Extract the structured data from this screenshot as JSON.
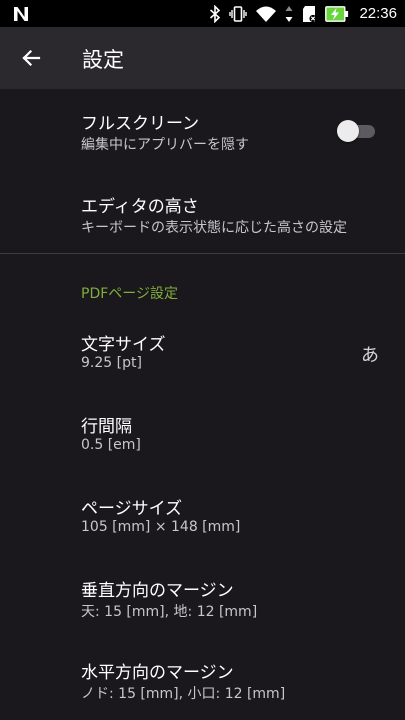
{
  "status_bar": {
    "time": "22:36",
    "icons": [
      "notification-n-icon",
      "bluetooth-icon",
      "vibrate-icon",
      "wifi-icon",
      "data-arrows-icon",
      "sd-card-icon",
      "battery-charging-icon"
    ]
  },
  "app_bar": {
    "back_icon": "arrow-back-icon",
    "title": "設定"
  },
  "settings": {
    "fullscreen": {
      "title": "フルスクリーン",
      "summary": "編集中にアプリバーを隠す",
      "enabled": false
    },
    "editor_height": {
      "title": "エディタの高さ",
      "summary": "キーボードの表示状態に応じた高さの設定"
    },
    "pdf_section": {
      "header": "PDFページ設定",
      "font_size": {
        "title": "文字サイズ",
        "summary": "9.25 [pt]",
        "preview": "あ"
      },
      "line_spacing": {
        "title": "行間隔",
        "summary": "0.5 [em]"
      },
      "page_size": {
        "title": "ページサイズ",
        "summary": "105 [mm] × 148 [mm]"
      },
      "vertical_margin": {
        "title": "垂直方向のマージン",
        "summary": "天: 15 [mm], 地: 12 [mm]"
      },
      "horizontal_margin": {
        "title": "水平方向のマージン",
        "summary": "ノド: 15 [mm], 小口: 12 [mm]"
      }
    }
  },
  "colors": {
    "background": "#1a181c",
    "app_bar": "#2b292d",
    "status_bar": "#000000",
    "accent": "#7fad3a",
    "summary_text": "#c8c6cb",
    "battery": "#6ad43e"
  }
}
